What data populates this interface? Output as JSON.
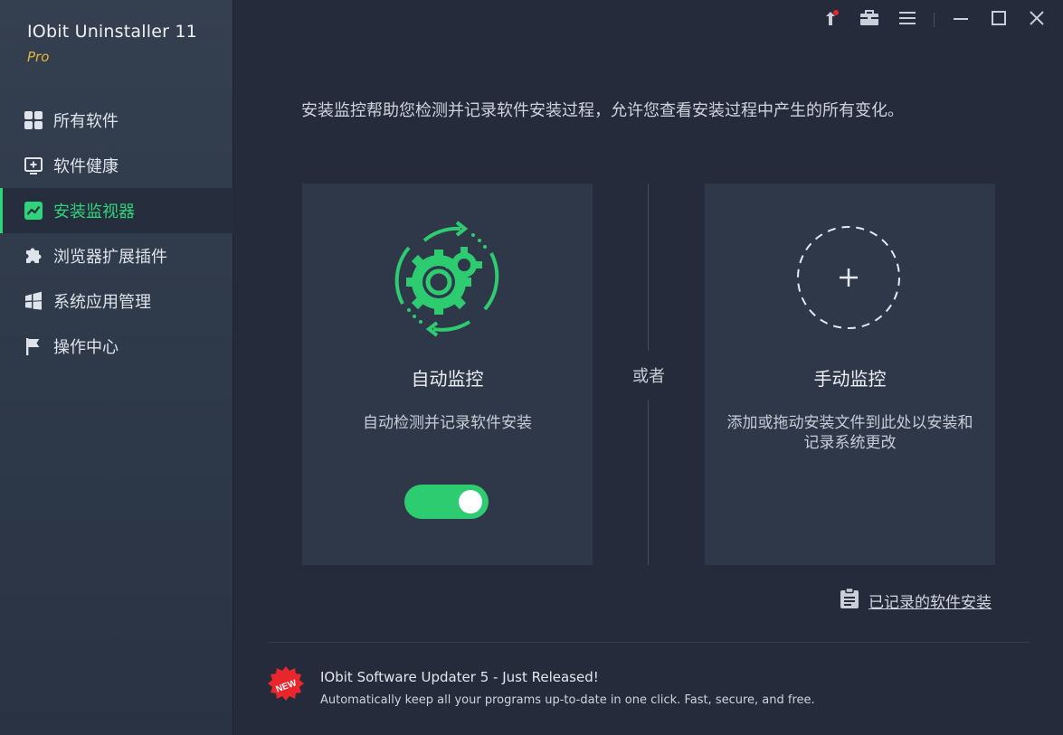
{
  "app": {
    "title": "IObit Uninstaller 11",
    "edition": "Pro"
  },
  "sidebar": {
    "items": [
      {
        "label": "所有软件",
        "icon": "grid-icon"
      },
      {
        "label": "软件健康",
        "icon": "health-plus-icon"
      },
      {
        "label": "安装监视器",
        "icon": "monitor-chart-icon",
        "active": true
      },
      {
        "label": "浏览器扩展插件",
        "icon": "puzzle-icon"
      },
      {
        "label": "系统应用管理",
        "icon": "windows-icon"
      },
      {
        "label": "操作中心",
        "icon": "flag-icon"
      }
    ]
  },
  "titlebar": {
    "icons": [
      "notification-icon",
      "toolbox-icon",
      "menu-icon",
      "minimize-icon",
      "maximize-icon",
      "close-icon"
    ]
  },
  "main": {
    "intro": "安装监控帮助您检测并记录软件安装过程，允许您查看安装过程中产生的所有变化。",
    "auto_card": {
      "title": "自动监控",
      "desc": "自动检测并记录软件安装",
      "icon": "auto-monitor-gear-icon",
      "toggle_on": true
    },
    "or_label": "或者",
    "manual_card": {
      "title": "手动监控",
      "desc": "添加或拖动安装文件到此处以安装和记录系统更改",
      "icon": "add-circle-icon"
    },
    "records_link": "已记录的软件安装"
  },
  "promo": {
    "badge": "NEW",
    "title": "IObit Software Updater 5 - Just Released!",
    "desc": "Automatically keep all your programs up-to-date in one click. Fast, secure, and free."
  },
  "colors": {
    "accent": "#2ed47a",
    "edition": "#e2b73a",
    "badge": "#e8262b"
  }
}
